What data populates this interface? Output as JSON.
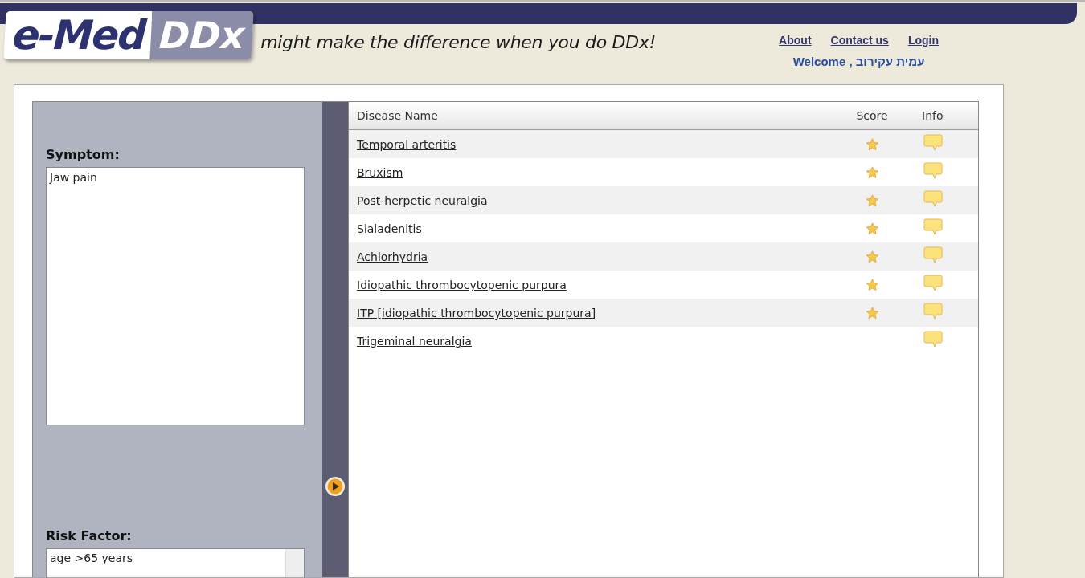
{
  "logo": {
    "part_1": "e-Med",
    "part_2": "DDx"
  },
  "tagline": "might make the difference when you do DDx!",
  "nav": [
    "About",
    "Contact us",
    "Login"
  ],
  "welcome": "Welcome , עמית עקירוב",
  "symptom": {
    "label": "Symptom:",
    "value": "Jaw pain"
  },
  "risk_factor": {
    "label": "Risk Factor:",
    "value": "age >65 years"
  },
  "table": {
    "columns": [
      "Disease Name",
      "Score",
      "Info"
    ],
    "rows": [
      {
        "name": "Temporal arteritis",
        "starred": true
      },
      {
        "name": "Bruxism",
        "starred": true
      },
      {
        "name": "Post-herpetic neuralgia",
        "starred": true
      },
      {
        "name": "Sialadenitis",
        "starred": true
      },
      {
        "name": "Achlorhydria",
        "starred": true
      },
      {
        "name": "Idiopathic thrombocytopenic purpura",
        "starred": true
      },
      {
        "name": "ITP [idiopathic thrombocytopenic purpura]",
        "starred": true
      },
      {
        "name": "Trigeminal neuralgia",
        "starred": false
      }
    ]
  }
}
